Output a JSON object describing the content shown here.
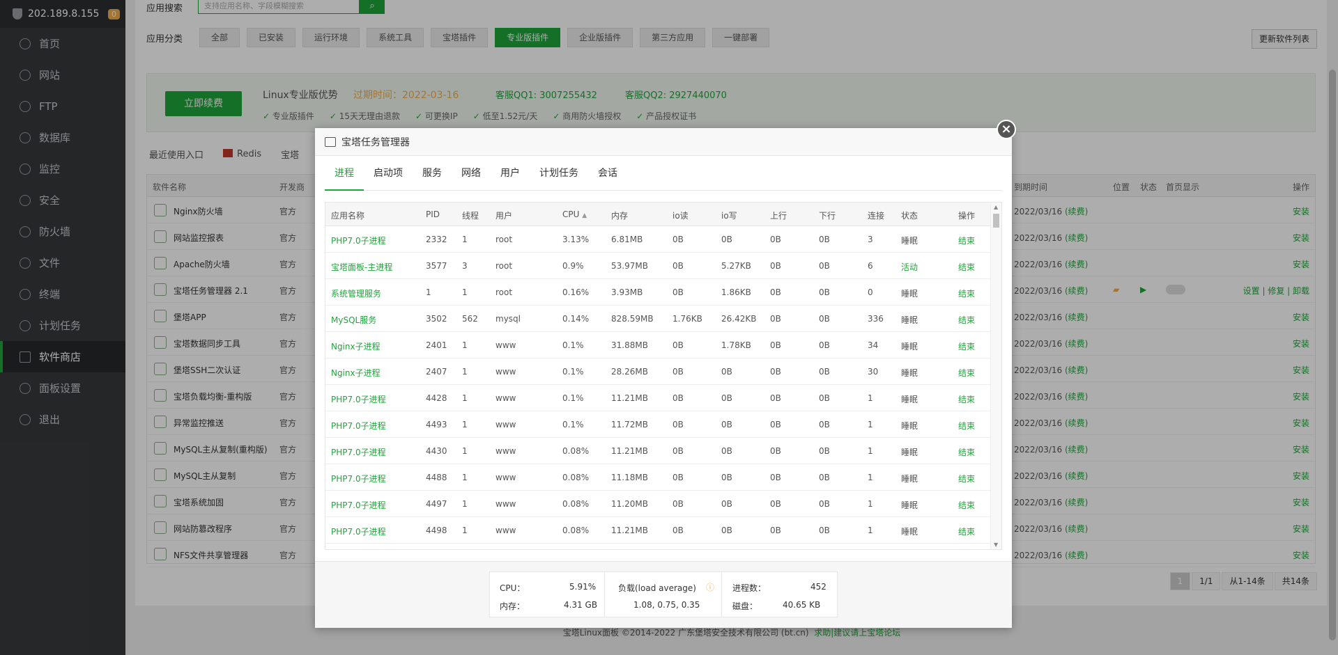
{
  "server": {
    "ip": "202.189.8.155",
    "badge": "0"
  },
  "nav": [
    {
      "label": "首页",
      "icon": "home-icon"
    },
    {
      "label": "网站",
      "icon": "globe-icon"
    },
    {
      "label": "FTP",
      "icon": "ftp-icon"
    },
    {
      "label": "数据库",
      "icon": "database-icon"
    },
    {
      "label": "监控",
      "icon": "monitor-icon"
    },
    {
      "label": "安全",
      "icon": "shield-icon"
    },
    {
      "label": "防火墙",
      "icon": "firewall-icon"
    },
    {
      "label": "文件",
      "icon": "folder-icon"
    },
    {
      "label": "终端",
      "icon": "terminal-icon"
    },
    {
      "label": "计划任务",
      "icon": "clock-icon"
    },
    {
      "label": "软件商店",
      "icon": "grid-icon",
      "active": true
    },
    {
      "label": "面板设置",
      "icon": "settings-icon"
    },
    {
      "label": "退出",
      "icon": "logout-icon"
    }
  ],
  "search": {
    "label": "应用搜索",
    "placeholder": "支持应用名称、字段模糊搜索"
  },
  "categories": {
    "label": "应用分类",
    "items": [
      "全部",
      "已安装",
      "运行环境",
      "系统工具",
      "宝塔插件",
      "专业版插件",
      "企业版插件",
      "第三方应用",
      "一键部署"
    ],
    "active_index": 5
  },
  "update_list_label": "更新软件列表",
  "promo": {
    "renew_label": "立即续费",
    "title": "Linux专业版优势",
    "expire": "过期时间：2022-03-16",
    "qq1": "客服QQ1: 3007255432",
    "qq2": "客服QQ2: 2927440070",
    "features": [
      "专业版插件",
      "15天无理由退款",
      "可更换IP",
      "低至1.52元/天",
      "商用防火墙授权",
      "产品授权证书"
    ]
  },
  "recent": {
    "label": "最近使用入口",
    "items": [
      "Redis",
      "宝塔"
    ]
  },
  "soft_table": {
    "headers": {
      "name": "软件名称",
      "dev": "开发商",
      "expire": "到期时间",
      "pos": "位置",
      "status": "状态",
      "home": "首页显示",
      "op": "操作"
    },
    "rows": [
      {
        "name": "Nginx防火墙",
        "dev": "官方",
        "expire": "2022/03/16",
        "renew": "(续费)",
        "op": "安装"
      },
      {
        "name": "网站监控报表",
        "dev": "官方",
        "expire": "2022/03/16",
        "renew": "(续费)",
        "op": "安装"
      },
      {
        "name": "Apache防火墙",
        "dev": "官方",
        "expire": "2022/03/16",
        "renew": "(续费)",
        "op": "安装"
      },
      {
        "name": "宝塔任务管理器 2.1",
        "dev": "官方",
        "expire": "2022/03/16",
        "renew": "(续费)",
        "op": "设置 | 修复 | 卸载",
        "installed": true
      },
      {
        "name": "堡塔APP",
        "dev": "官方",
        "expire": "2022/03/16",
        "renew": "(续费)",
        "op": "安装"
      },
      {
        "name": "宝塔数据同步工具",
        "dev": "官方",
        "expire": "2022/03/16",
        "renew": "(续费)",
        "op": "安装"
      },
      {
        "name": "堡塔SSH二次认证",
        "dev": "官方",
        "expire": "2022/03/16",
        "renew": "(续费)",
        "op": "安装"
      },
      {
        "name": "宝塔负载均衡-重构版",
        "dev": "官方",
        "expire": "2022/03/16",
        "renew": "(续费)",
        "op": "安装"
      },
      {
        "name": "异常监控推送",
        "dev": "官方",
        "expire": "2022/03/16",
        "renew": "(续费)",
        "op": "安装"
      },
      {
        "name": "MySQL主从复制(重构版)",
        "dev": "官方",
        "expire": "2022/03/16",
        "renew": "(续费)",
        "op": "安装"
      },
      {
        "name": "MySQL主从复制",
        "dev": "官方",
        "expire": "2022/03/16",
        "renew": "(续费)",
        "op": "安装"
      },
      {
        "name": "宝塔系统加固",
        "dev": "官方",
        "expire": "2022/03/16",
        "renew": "(续费)",
        "op": "安装"
      },
      {
        "name": "网站防篡改程序",
        "dev": "官方",
        "expire": "2022/03/16",
        "renew": "(续费)",
        "op": "安装"
      },
      {
        "name": "NFS文件共享管理器",
        "dev": "官方",
        "expire": "2022/03/16",
        "renew": "(续费)",
        "op": "安装"
      }
    ]
  },
  "pager": {
    "current": "1",
    "pages": "1/1",
    "range": "从1-14条",
    "total": "共14条"
  },
  "footer": {
    "copyright": "宝塔Linux面板 ©2014-2022 广东堡塔安全技术有限公司 (bt.cn)",
    "link": "求助|建议请上宝塔论坛"
  },
  "modal": {
    "title": "宝塔任务管理器",
    "close": "×",
    "tabs": [
      "进程",
      "启动项",
      "服务",
      "网络",
      "用户",
      "计划任务",
      "会话"
    ],
    "active_tab": 0,
    "headers": {
      "name": "应用名称",
      "pid": "PID",
      "threads": "线程",
      "user": "用户",
      "cpu": "CPU",
      "mem": "内存",
      "io_read": "io读",
      "io_write": "io写",
      "up": "上行",
      "down": "下行",
      "conn": "连接",
      "status": "状态",
      "op": "操作"
    },
    "processes": [
      {
        "name": "PHP7.0子进程",
        "pid": "2332",
        "threads": "1",
        "user": "root",
        "cpu": "3.13%",
        "mem": "6.81MB",
        "io_read": "0B",
        "io_write": "0B",
        "up": "0B",
        "down": "0B",
        "conn": "3",
        "status": "睡眠",
        "op": "结束"
      },
      {
        "name": "宝塔面板-主进程",
        "pid": "3577",
        "threads": "3",
        "user": "root",
        "cpu": "0.9%",
        "mem": "53.97MB",
        "io_read": "0B",
        "io_write": "5.27KB",
        "up": "0B",
        "down": "0B",
        "conn": "6",
        "status": "活动",
        "op": "结束"
      },
      {
        "name": "系统管理服务",
        "pid": "1",
        "threads": "1",
        "user": "root",
        "cpu": "0.16%",
        "mem": "3.93MB",
        "io_read": "0B",
        "io_write": "1.86KB",
        "up": "0B",
        "down": "0B",
        "conn": "0",
        "status": "睡眠",
        "op": "结束"
      },
      {
        "name": "MySQL服务",
        "pid": "3502",
        "threads": "562",
        "user": "mysql",
        "cpu": "0.14%",
        "mem": "828.59MB",
        "io_read": "1.76KB",
        "io_write": "26.42KB",
        "up": "0B",
        "down": "0B",
        "conn": "336",
        "status": "睡眠",
        "op": "结束"
      },
      {
        "name": "Nginx子进程",
        "pid": "2401",
        "threads": "1",
        "user": "www",
        "cpu": "0.1%",
        "mem": "31.88MB",
        "io_read": "0B",
        "io_write": "1.78KB",
        "up": "0B",
        "down": "0B",
        "conn": "34",
        "status": "睡眠",
        "op": "结束"
      },
      {
        "name": "Nginx子进程",
        "pid": "2407",
        "threads": "1",
        "user": "www",
        "cpu": "0.1%",
        "mem": "28.26MB",
        "io_read": "0B",
        "io_write": "0B",
        "up": "0B",
        "down": "0B",
        "conn": "30",
        "status": "睡眠",
        "op": "结束"
      },
      {
        "name": "PHP7.0子进程",
        "pid": "4428",
        "threads": "1",
        "user": "www",
        "cpu": "0.1%",
        "mem": "11.21MB",
        "io_read": "0B",
        "io_write": "0B",
        "up": "0B",
        "down": "0B",
        "conn": "1",
        "status": "睡眠",
        "op": "结束"
      },
      {
        "name": "PHP7.0子进程",
        "pid": "4493",
        "threads": "1",
        "user": "www",
        "cpu": "0.1%",
        "mem": "11.72MB",
        "io_read": "0B",
        "io_write": "0B",
        "up": "0B",
        "down": "0B",
        "conn": "1",
        "status": "睡眠",
        "op": "结束"
      },
      {
        "name": "PHP7.0子进程",
        "pid": "4430",
        "threads": "1",
        "user": "www",
        "cpu": "0.08%",
        "mem": "11.21MB",
        "io_read": "0B",
        "io_write": "0B",
        "up": "0B",
        "down": "0B",
        "conn": "1",
        "status": "睡眠",
        "op": "结束"
      },
      {
        "name": "PHP7.0子进程",
        "pid": "4488",
        "threads": "1",
        "user": "www",
        "cpu": "0.08%",
        "mem": "11.18MB",
        "io_read": "0B",
        "io_write": "0B",
        "up": "0B",
        "down": "0B",
        "conn": "1",
        "status": "睡眠",
        "op": "结束"
      },
      {
        "name": "PHP7.0子进程",
        "pid": "4497",
        "threads": "1",
        "user": "www",
        "cpu": "0.08%",
        "mem": "11.20MB",
        "io_read": "0B",
        "io_write": "0B",
        "up": "0B",
        "down": "0B",
        "conn": "1",
        "status": "睡眠",
        "op": "结束"
      },
      {
        "name": "PHP7.0子进程",
        "pid": "4498",
        "threads": "1",
        "user": "www",
        "cpu": "0.08%",
        "mem": "11.21MB",
        "io_read": "0B",
        "io_write": "0B",
        "up": "0B",
        "down": "0B",
        "conn": "1",
        "status": "睡眠",
        "op": "结束"
      }
    ],
    "stats": {
      "cpu_label": "CPU：",
      "cpu": "5.91%",
      "mem_label": "内存：",
      "mem": "4.31 GB",
      "load_label": "负载(load average)",
      "load": "1.08, 0.75, 0.35",
      "proc_label": "进程数：",
      "proc": "452",
      "disk_label": "磁盘：",
      "disk": "40.65 KB"
    }
  },
  "colors": {
    "accent": "#20a53a",
    "sidebar": "#36393c",
    "warning": "#f0ad4e"
  }
}
